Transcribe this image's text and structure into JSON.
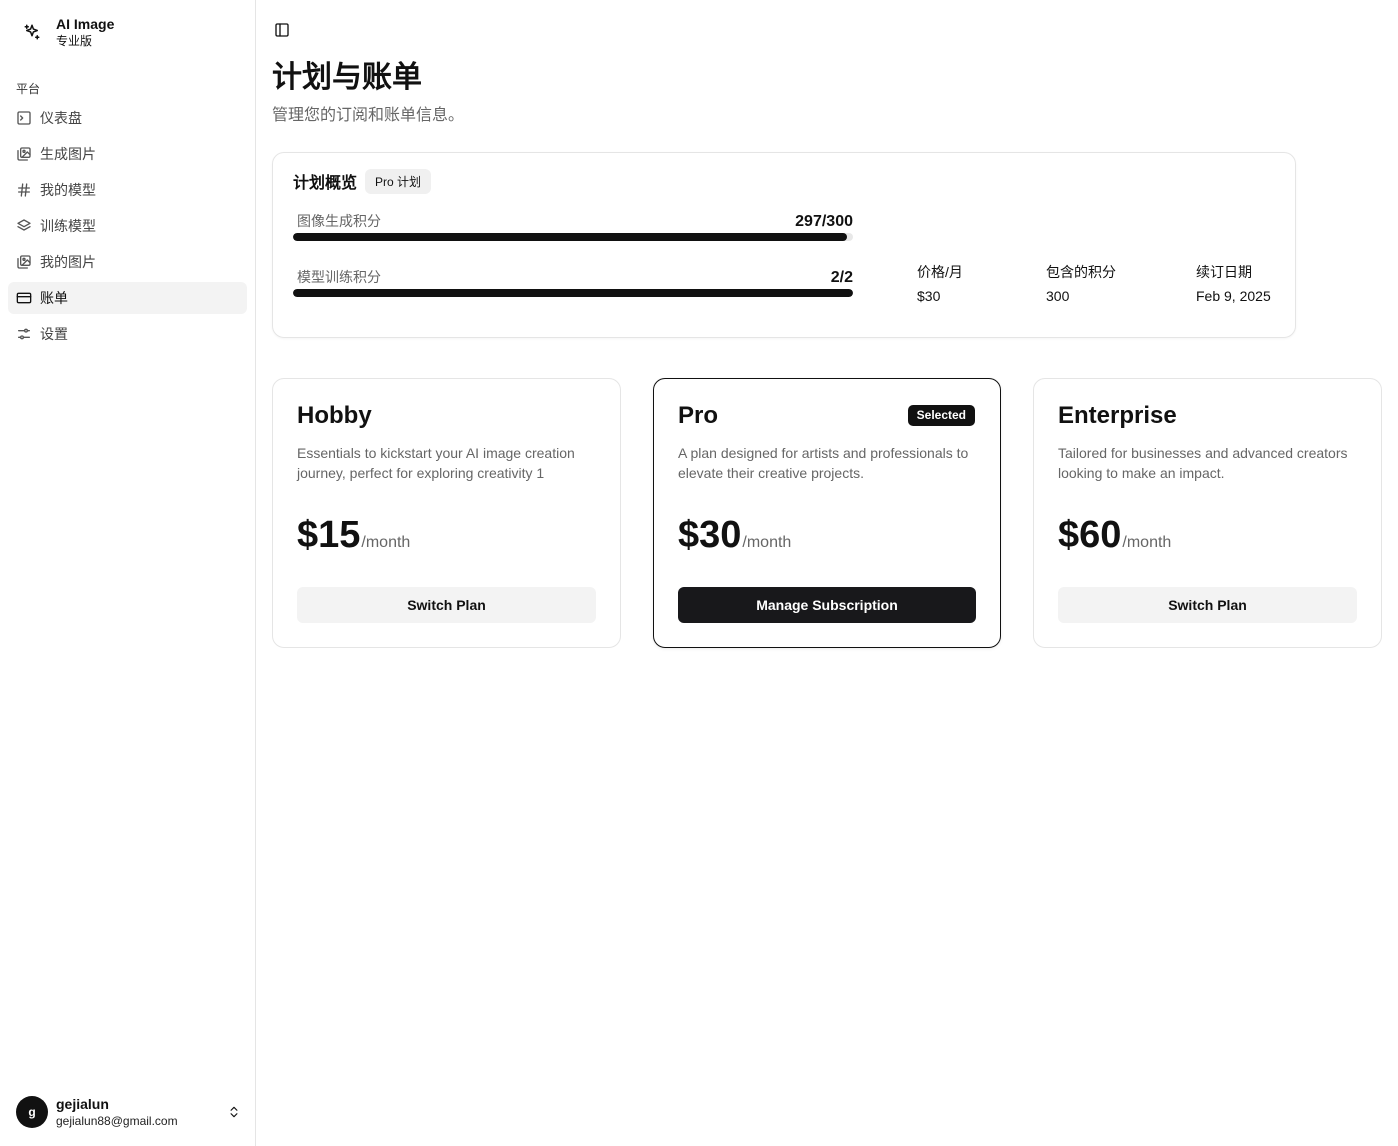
{
  "sidebar": {
    "brand": {
      "name": "AI Image",
      "tier": "专业版",
      "icon": "sparkles-icon"
    },
    "group_label": "平台",
    "items": [
      {
        "label": "仪表盘",
        "icon": "terminal-icon",
        "active": false
      },
      {
        "label": "生成图片",
        "icon": "images-icon",
        "active": false
      },
      {
        "label": "我的模型",
        "icon": "hash-icon",
        "active": false
      },
      {
        "label": "训练模型",
        "icon": "layers-icon",
        "active": false
      },
      {
        "label": "我的图片",
        "icon": "images-icon",
        "active": false
      },
      {
        "label": "账单",
        "icon": "credit-card-icon",
        "active": true
      },
      {
        "label": "设置",
        "icon": "sliders-icon",
        "active": false
      }
    ],
    "user": {
      "initial": "g",
      "name": "gejialun",
      "email": "gejialun88@gmail.com"
    }
  },
  "header": {
    "title": "计划与账单",
    "subtitle": "管理您的订阅和账单信息。"
  },
  "overview": {
    "title": "计划概览",
    "badge": "Pro 计划",
    "meters": [
      {
        "label": "图像生成积分",
        "value": "297/300",
        "fraction": 0.99
      },
      {
        "label": "模型训练积分",
        "value": "2/2",
        "fraction": 1.0
      }
    ],
    "stats": [
      {
        "label": "价格/月",
        "value": "$30"
      },
      {
        "label": "包含的积分",
        "value": "300"
      },
      {
        "label": "续订日期",
        "value": "Feb 9, 2025"
      }
    ]
  },
  "plans": [
    {
      "name": "Hobby",
      "description": "Essentials to kickstart your AI image creation journey, perfect for exploring creativity 1",
      "price": "$15",
      "period": "/month",
      "button": "Switch Plan",
      "selected": false
    },
    {
      "name": "Pro",
      "badge": "Selected",
      "description": "A plan designed for artists and professionals to elevate their creative projects.",
      "price": "$30",
      "period": "/month",
      "button": "Manage Subscription",
      "selected": true
    },
    {
      "name": "Enterprise",
      "description": "Tailored for businesses and advanced creators looking to make an impact.",
      "price": "$60",
      "period": "/month",
      "button": "Switch Plan",
      "selected": false
    }
  ],
  "colors": {
    "accent": "#18181b",
    "muted_text": "#666666",
    "border": "#e5e5e5",
    "active_bg": "#f3f3f3"
  }
}
